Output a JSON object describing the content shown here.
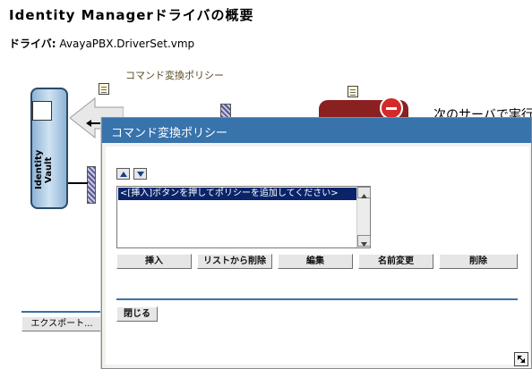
{
  "page": {
    "title": "Identity Managerドライバの概要",
    "driver_label": "ドライバ:",
    "driver_value": "AvayaPBX.DriverSet.vmp"
  },
  "overview": {
    "command_policy_label": "コマンド変換ポリシー",
    "vault_label": "Identity Vault",
    "server_text": "次のサーバで実行",
    "export_button": "エクスポート..."
  },
  "dialog": {
    "title": "コマンド変換ポリシー",
    "list_items": [
      "<[挿入]ボタンを押してポリシーを追加してください>"
    ],
    "buttons": {
      "insert": "挿入",
      "remove_from_list": "リストから削除",
      "edit": "編集",
      "rename": "名前変更",
      "delete": "削除",
      "close": "閉じる"
    }
  },
  "icons": [
    "up-arrow-icon",
    "down-arrow-icon",
    "note-icon",
    "stop-icon",
    "resize-grip-icon"
  ],
  "colors": {
    "titlebar": "#3873ac",
    "divider": "#3b73ad",
    "selection": "#0a246a"
  }
}
